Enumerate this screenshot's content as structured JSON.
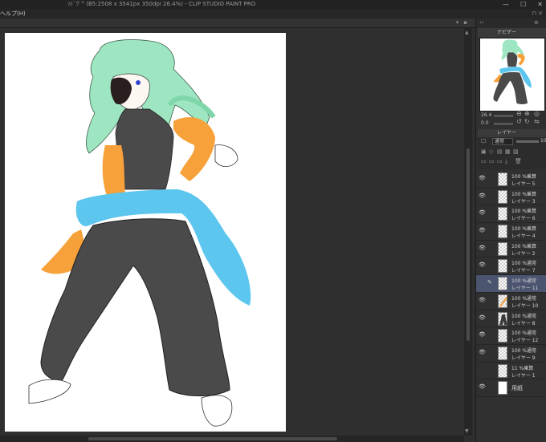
{
  "titlebar": {
    "title": "ｿﾄﾞｳﾞ° (B5:2508 x 3541px 350dpi 26.4%) - CLIP STUDIO PAINT PRO",
    "minimize": "—",
    "maximize": "☐",
    "close": "✕"
  },
  "menubar": {
    "help": "ヘルプ(H)",
    "right": "⊓ ✕"
  },
  "navigator": {
    "tab_label": "ナビゲー",
    "zoom_value": "26.4",
    "rotate_value": "0.0"
  },
  "layer_panel": {
    "tab_label": "レイヤー",
    "blend_mode": "通常",
    "opacity_value": "10"
  },
  "layers": [
    {
      "mode": "100 %乗算",
      "name": "レイヤー 5",
      "visible": true,
      "selected": false,
      "thumb": "blank"
    },
    {
      "mode": "100 %乗算",
      "name": "レイヤー 3",
      "visible": true,
      "selected": false,
      "thumb": "blank"
    },
    {
      "mode": "100 %乗算",
      "name": "レイヤー 6",
      "visible": true,
      "selected": false,
      "thumb": "blank"
    },
    {
      "mode": "100 %乗算",
      "name": "レイヤー 4",
      "visible": true,
      "selected": false,
      "thumb": "blank"
    },
    {
      "mode": "100 %乗算",
      "name": "レイヤー 2",
      "visible": true,
      "selected": false,
      "thumb": "blank"
    },
    {
      "mode": "100 %通常",
      "name": "レイヤー 7",
      "visible": true,
      "selected": false,
      "thumb": "blank"
    },
    {
      "mode": "100 %通常",
      "name": "レイヤー 11",
      "visible": false,
      "selected": true,
      "thumb": "blank"
    },
    {
      "mode": "100 %通常",
      "name": "レイヤー 10",
      "visible": true,
      "selected": false,
      "thumb": "orange"
    },
    {
      "mode": "100 %通常",
      "name": "レイヤー 8",
      "visible": true,
      "selected": false,
      "thumb": "figure"
    },
    {
      "mode": "100 %通常",
      "name": "レイヤー 12",
      "visible": true,
      "selected": false,
      "thumb": "blank"
    },
    {
      "mode": "100 %通常",
      "name": "レイヤー 9",
      "visible": true,
      "selected": false,
      "thumb": "blank"
    },
    {
      "mode": "11 %乗算",
      "name": "レイヤー 1",
      "visible": false,
      "selected": false,
      "thumb": "blank"
    },
    {
      "mode": "",
      "name": "用紙",
      "visible": true,
      "selected": false,
      "thumb": "paper"
    }
  ],
  "colors": {
    "hair": "#9ee6c1",
    "body": "#4a4a4a",
    "orange": "#f7a13a",
    "blue": "#5cc6ef",
    "eyepatch": "#2b1e1e",
    "selected_layer": "#4b5570"
  },
  "icons": {
    "eye": "eye-icon",
    "pen": "pen-icon"
  }
}
